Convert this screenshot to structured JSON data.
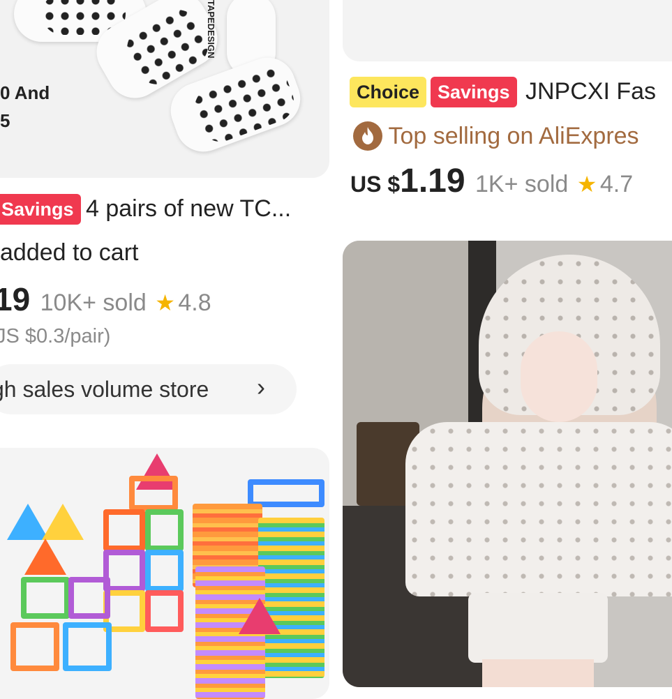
{
  "left_card": {
    "image_caption": [
      "0 And",
      "5"
    ],
    "image_print": "TAPEDESIGN",
    "savings_badge": "Savings",
    "title": "4 pairs of new TC...",
    "cart_note": "added to cart",
    "price_fragment": "19",
    "sold": "10K+ sold",
    "rating": "4.8",
    "star_glyph": "★",
    "unit_price": "JS $0.3/pair)",
    "store_link": "gh sales volume store",
    "store_chevron": "›"
  },
  "right_card": {
    "choice_badge": "Choice",
    "savings_badge": "Savings",
    "title": "JNPCXI Fas",
    "top_selling": "Top selling on AliExpres",
    "price_currency": "US $",
    "price": "1.19",
    "sold": "1K+ sold",
    "rating": "4.7",
    "star_glyph": "★"
  },
  "colors": {
    "savings": "#f0394f",
    "choice": "#fde65d",
    "muted": "#8a8a8a",
    "star": "#f5b400",
    "top_selling_icon": "#a26a3f"
  },
  "icons": [
    "fire-icon",
    "star-icon",
    "chevron-right-icon"
  ]
}
